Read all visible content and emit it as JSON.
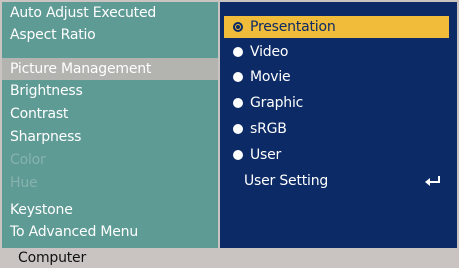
{
  "menu": {
    "items": [
      {
        "label": "Auto Adjust Executed"
      },
      {
        "label": "Aspect Ratio"
      },
      {
        "label": "Picture Management"
      },
      {
        "label": "Brightness"
      },
      {
        "label": "Contrast"
      },
      {
        "label": "Sharpness"
      },
      {
        "label": "Color"
      },
      {
        "label": "Hue"
      },
      {
        "label": "Keystone"
      },
      {
        "label": "To Advanced Menu"
      }
    ],
    "selected": "Picture Management",
    "disabled": [
      "Color",
      "Hue"
    ]
  },
  "submenu": {
    "options": [
      {
        "label": "Presentation"
      },
      {
        "label": "Video"
      },
      {
        "label": "Movie"
      },
      {
        "label": "Graphic"
      },
      {
        "label": "sRGB"
      },
      {
        "label": "User"
      }
    ],
    "selected": "Presentation",
    "user_setting_label": "User Setting",
    "enter_icon": "enter-return-icon"
  },
  "footer": {
    "source": "Computer"
  },
  "colors": {
    "left_panel": "#5f9b95",
    "right_panel": "#0b2a66",
    "highlight": "#f0bc3a",
    "selected_left": "#b3b3b0",
    "footer": "#c9c4c1"
  }
}
